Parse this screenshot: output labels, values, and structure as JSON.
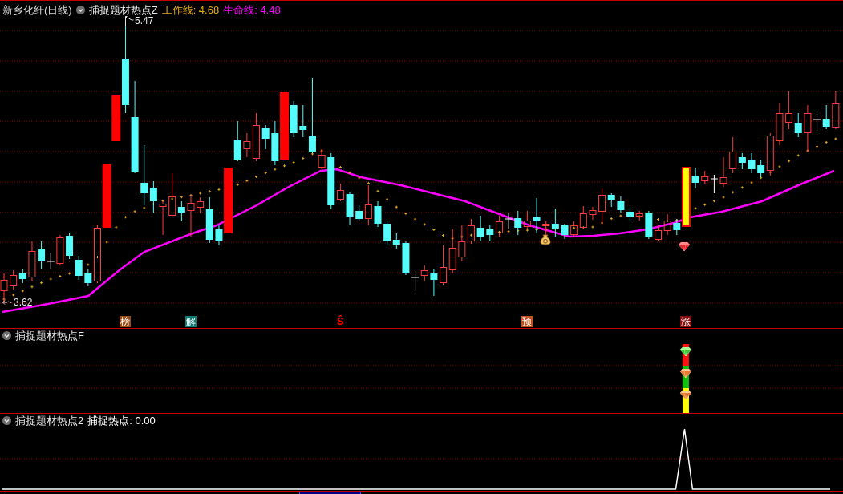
{
  "main_panel": {
    "title": "新乡化纤(日线)",
    "indicator": "捕捉题材热点Z",
    "legend": [
      {
        "text": "工作线: 4.68",
        "color": "#e6a817"
      },
      {
        "text": "生命线: 4.48",
        "color": "#ff00ff"
      }
    ],
    "high_label": "5.47",
    "low_label": "3.62",
    "signal_marks": [
      {
        "kind": "badge",
        "text": "榜",
        "color": "#9c4a14"
      },
      {
        "kind": "badge",
        "text": "解",
        "color": "#127a74"
      },
      {
        "kind": "glyph",
        "text": "Ŝ",
        "color": "#ff0000"
      },
      {
        "kind": "badge",
        "text": "预",
        "color": "#c0501c"
      },
      {
        "kind": "badge",
        "text": "涨",
        "color": "#8a1010"
      }
    ]
  },
  "panel_2": {
    "title": "捕捉题材热点F"
  },
  "panel_3": {
    "title": "捕捉题材热点2",
    "reading": "捕捉热点: 0.00"
  }
}
